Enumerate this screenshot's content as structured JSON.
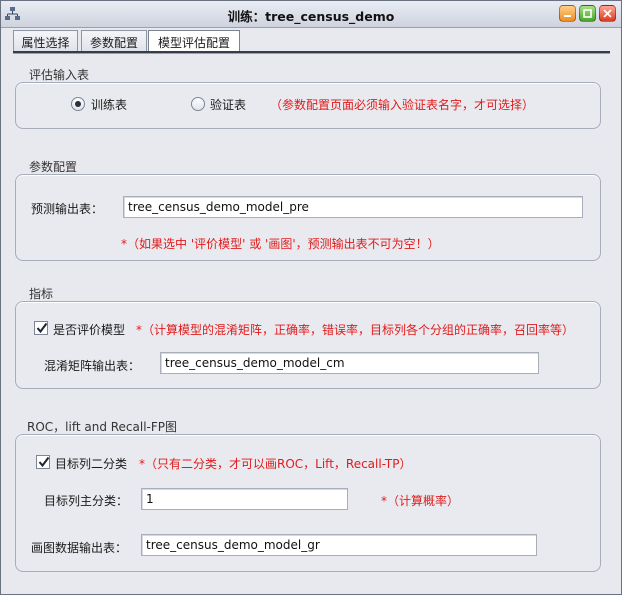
{
  "window": {
    "title": "训练：tree_census_demo",
    "icons": {
      "app": "tree-icon",
      "minimize": "minimize-icon",
      "maximize": "maximize-icon",
      "close": "close-icon"
    }
  },
  "tabs": [
    {
      "label": "属性选择",
      "active": false
    },
    {
      "label": "参数配置",
      "active": false
    },
    {
      "label": "模型评估配置",
      "active": true
    }
  ],
  "eval_input": {
    "title": "评估输入表",
    "options": [
      {
        "label": "训练表",
        "selected": true
      },
      {
        "label": "验证表",
        "selected": false
      }
    ],
    "note": "（参数配置页面必须输入验证表名字，才可选择）"
  },
  "param_config": {
    "title": "参数配置",
    "predict_label": "预测输出表：",
    "predict_value": "tree_census_demo_model_pre",
    "note": "*（如果选中 '评价模型' 或 '画图'，预测输出表不可为空！）"
  },
  "metrics": {
    "title": "指标",
    "evaluate_label": "是否评价模型",
    "evaluate_checked": true,
    "evaluate_note": "*（计算模型的混淆矩阵，正确率，错误率，目标列各个分组的正确率，召回率等）",
    "cm_label": "混淆矩阵输出表：",
    "cm_value": "tree_census_demo_model_cm"
  },
  "roc": {
    "title": "ROC，lift and Recall-FP图",
    "binary_label": "目标列二分类",
    "binary_checked": true,
    "binary_note": "*（只有二分类，才可以画ROC，Lift，Recall-TP）",
    "main_class_label": "目标列主分类：",
    "main_class_value": "1",
    "main_class_note": "*（计算概率）",
    "plot_label": "画图数据输出表：",
    "plot_value": "tree_census_demo_model_gr"
  },
  "colors": {
    "note_red": "#e01b1b",
    "panel_bg": "#e9eaef",
    "window_bg": "#e8e9ee"
  }
}
